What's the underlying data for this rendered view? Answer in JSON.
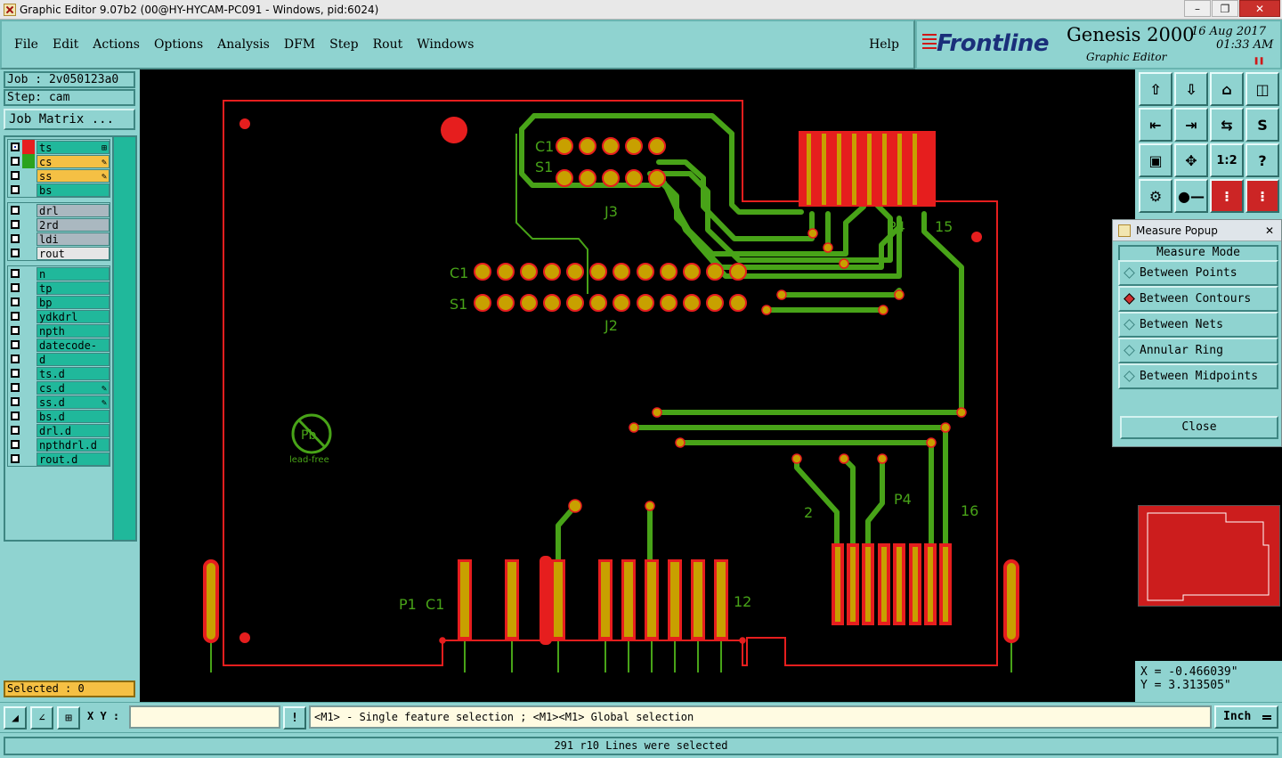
{
  "window": {
    "title": "Graphic Editor 9.07b2 (00@HY-HYCAM-PC091 - Windows, pid:6024)"
  },
  "menu": [
    "File",
    "Edit",
    "Actions",
    "Options",
    "Analysis",
    "DFM",
    "Step",
    "Rout",
    "Windows"
  ],
  "help_label": "Help",
  "brand": {
    "logo": "Frontline",
    "product": "Genesis 2000",
    "subtitle": "Graphic Editor",
    "date": "16 Aug 2017",
    "time": "01:33 AM"
  },
  "job": {
    "job_label": "Job : 2v050123a0",
    "step_label": "Step: cam",
    "matrix_button": "Job Matrix ..."
  },
  "layer_groups": [
    [
      {
        "name": "ts",
        "bg": "#20b89b",
        "swatch": "#e61e1e",
        "on": true,
        "mark": "⊞"
      },
      {
        "name": "cs",
        "bg": "#f5c044",
        "swatch": "#2aa31e",
        "on": false,
        "mark": "✎"
      },
      {
        "name": "ss",
        "bg": "#f5c044",
        "swatch": "",
        "on": false,
        "mark": "✎"
      },
      {
        "name": "bs",
        "bg": "#20b89b",
        "swatch": "",
        "on": false,
        "mark": ""
      }
    ],
    [
      {
        "name": "drl",
        "bg": "#aab8c0",
        "swatch": "",
        "on": false,
        "mark": ""
      },
      {
        "name": "2rd",
        "bg": "#aab8c0",
        "swatch": "",
        "on": false,
        "mark": ""
      },
      {
        "name": "ldi",
        "bg": "#aab8c0",
        "swatch": "",
        "on": false,
        "mark": ""
      },
      {
        "name": "rout",
        "bg": "#e6e6e6",
        "swatch": "",
        "on": false,
        "mark": ""
      }
    ],
    [
      {
        "name": "n",
        "bg": "#20b89b",
        "swatch": "",
        "on": false,
        "mark": ""
      },
      {
        "name": "tp",
        "bg": "#20b89b",
        "swatch": "",
        "on": false,
        "mark": ""
      },
      {
        "name": "bp",
        "bg": "#20b89b",
        "swatch": "",
        "on": false,
        "mark": ""
      },
      {
        "name": "ydkdrl",
        "bg": "#20b89b",
        "swatch": "",
        "on": false,
        "mark": ""
      },
      {
        "name": "npth",
        "bg": "#20b89b",
        "swatch": "",
        "on": false,
        "mark": ""
      },
      {
        "name": "datecode-ss",
        "bg": "#20b89b",
        "swatch": "",
        "on": false,
        "mark": ""
      },
      {
        "name": "d",
        "bg": "#20b89b",
        "swatch": "",
        "on": false,
        "mark": ""
      },
      {
        "name": "ts.d",
        "bg": "#20b89b",
        "swatch": "",
        "on": false,
        "mark": ""
      },
      {
        "name": "cs.d",
        "bg": "#20b89b",
        "swatch": "",
        "on": false,
        "mark": "✎"
      },
      {
        "name": "ss.d",
        "bg": "#20b89b",
        "swatch": "",
        "on": false,
        "mark": "✎"
      },
      {
        "name": "bs.d",
        "bg": "#20b89b",
        "swatch": "",
        "on": false,
        "mark": ""
      },
      {
        "name": "drl.d",
        "bg": "#20b89b",
        "swatch": "",
        "on": false,
        "mark": ""
      },
      {
        "name": "npthdrl.d",
        "bg": "#20b89b",
        "swatch": "",
        "on": false,
        "mark": ""
      },
      {
        "name": "rout.d",
        "bg": "#20b89b",
        "swatch": "",
        "on": false,
        "mark": ""
      }
    ]
  ],
  "selected_label": "Selected : 0",
  "board_labels": {
    "c1_j3": "C1",
    "s1_j3": "S1",
    "j3": "J3",
    "c1_j2": "C1",
    "s1_j2": "S1",
    "j2": "J2",
    "p4_top": "P4",
    "n15": "15",
    "p4_bot": "P4",
    "n2": "2",
    "n16": "16",
    "p1": "P1",
    "c1_p1": "C1",
    "n12": "12",
    "pb": "Pb",
    "lead_free": "lead-free"
  },
  "measure": {
    "title": "Measure Popup",
    "mode_header": "Measure Mode",
    "options": [
      {
        "label": "Between Points",
        "active": false
      },
      {
        "label": "Between Contours",
        "active": true
      },
      {
        "label": "Between Nets",
        "active": false
      },
      {
        "label": "Annular Ring",
        "active": false
      },
      {
        "label": "Between Midpoints",
        "active": false
      }
    ],
    "close_label": "Close"
  },
  "coords": {
    "x": "X = -0.466039\"",
    "y": "Y = 3.313505\""
  },
  "toolbar_icons": [
    "zoom-home-icon",
    "zoom-down-icon",
    "zoom-home-grid-icon",
    "split-view-icon",
    "pan-left-icon",
    "pan-right-icon",
    "swap-icon",
    "step-icon",
    "fit-icon",
    "center-icon",
    "scale-1-2-icon",
    "help-icon",
    "tools-icon",
    "key-icon",
    "layer-color-icon",
    "layer-color-alt-icon"
  ],
  "bottom": {
    "xy_label": "X Y :",
    "xy_value": "",
    "warn_icon": "!",
    "hint": "<M1> - Single feature selection ; <M1><M1> Global selection",
    "unit": "Inch",
    "status": "291 r10 Lines were selected"
  },
  "colors": {
    "pad": "#c8a000",
    "copper": "#e61e1e",
    "trace": "#48a318",
    "panel": "#8fd3d0"
  }
}
